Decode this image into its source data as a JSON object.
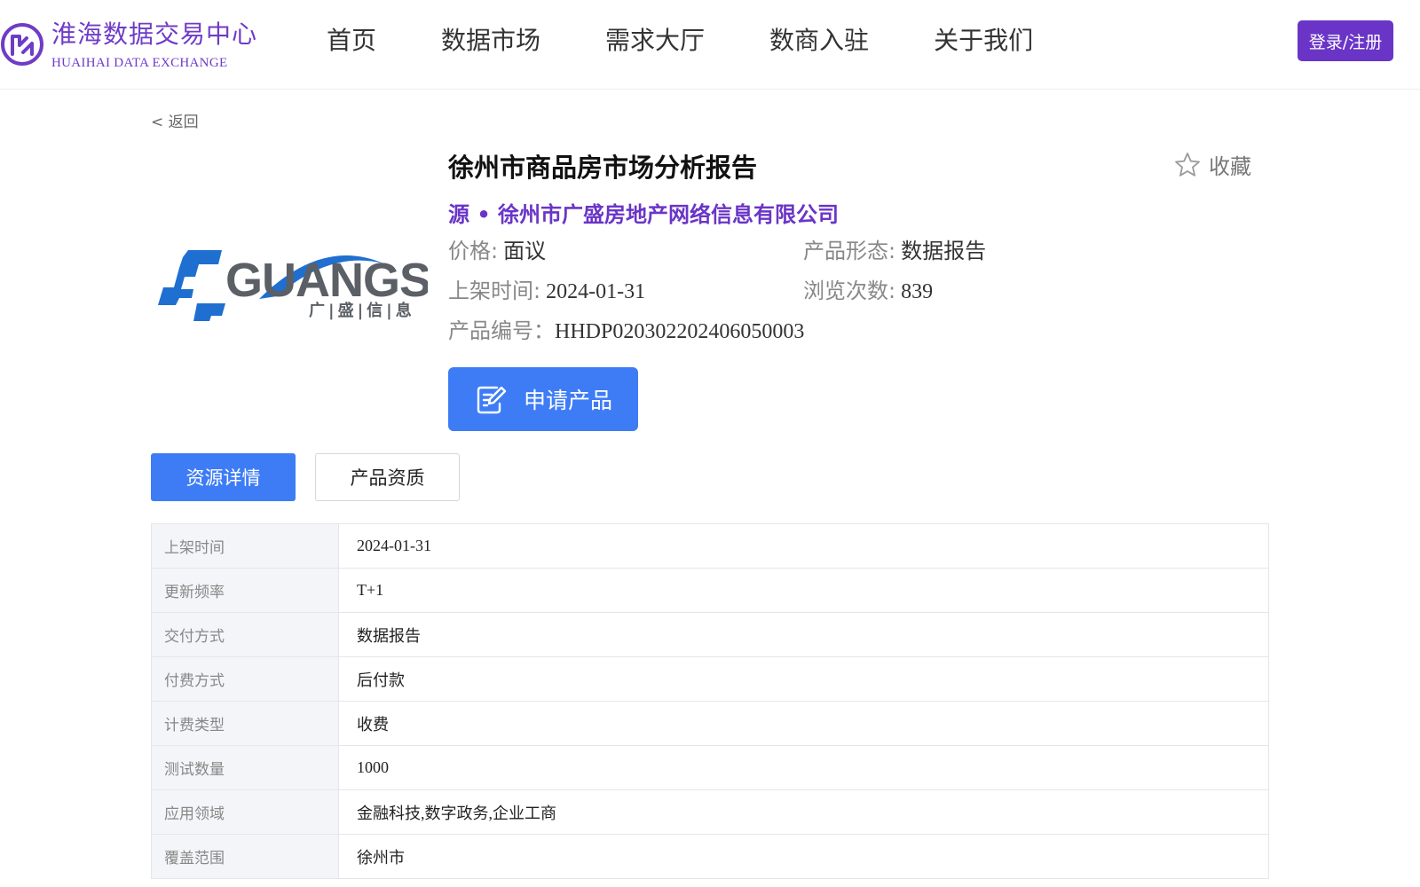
{
  "header": {
    "logo_cn": "淮海数据交易中心",
    "logo_en": "HUAIHAI DATA EXCHANGE",
    "nav": [
      "首页",
      "数据市场",
      "需求大厅",
      "数商入驻",
      "关于我们"
    ],
    "login_label": "登录/注册"
  },
  "back_label": "< 返回",
  "product": {
    "logo_text": "GUANGS",
    "logo_sub": "广|盛|信|息",
    "title": "徐州市商品房市场分析报告",
    "favorite_label": "收藏",
    "source": "源 • 徐州市广盛房地产网络信息有限公司",
    "price_key": "价格:",
    "price_value": "面议",
    "form_key": "产品形态:",
    "form_value": "数据报告",
    "listed_key": "上架时间:",
    "listed_value": "2024-01-31",
    "views_key": "浏览次数:",
    "views_value": "839",
    "code_key": "产品编号：",
    "code_value": "HHDP020302202406050003",
    "apply_label": "申请产品"
  },
  "tabs": [
    "资源详情",
    "产品资质"
  ],
  "details": [
    {
      "k": "上架时间",
      "v": "2024-01-31"
    },
    {
      "k": "更新频率",
      "v": "T+1"
    },
    {
      "k": "交付方式",
      "v": "数据报告"
    },
    {
      "k": "付费方式",
      "v": "后付款"
    },
    {
      "k": "计费类型",
      "v": "收费"
    },
    {
      "k": "测试数量",
      "v": "1000"
    },
    {
      "k": "应用领域",
      "v": "金融科技,数字政务,企业工商"
    },
    {
      "k": "覆盖范围",
      "v": "徐州市"
    }
  ],
  "colors": {
    "brand_purple": "#6a35c7",
    "primary_blue": "#3e7cf6",
    "logo_blue": "#1f6fd0",
    "logo_gray": "#5b5f66"
  }
}
